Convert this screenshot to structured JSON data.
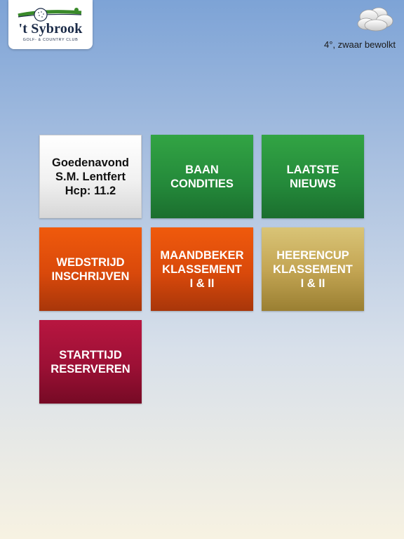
{
  "header": {
    "logo": {
      "name": "'t Sybrook",
      "subtitle": "GOLF- & COUNTRY CLUB"
    },
    "weather": {
      "icon": "cloud-icon",
      "text": "4°, zwaar bewolkt"
    }
  },
  "tiles": [
    {
      "label": "Goedenavond\nS.M. Lentfert\nHcp: 11.2",
      "color": "#f2f2f2"
    },
    {
      "label": "BAAN\nCONDITIES",
      "color": "#24893a"
    },
    {
      "label": "LAATSTE\nNIEUWS",
      "color": "#24893a"
    },
    {
      "label": "WEDSTRIJD\nINSCHRIJVEN",
      "color": "#d9490b"
    },
    {
      "label": "MAANDBEKER\nKLASSEMENT\nI & II",
      "color": "#d9490b"
    },
    {
      "label": "HEERENCUP\nKLASSEMENT\nI & II",
      "color": "#c4a654"
    },
    {
      "label": "STARTTIJD\nRESERVEREN",
      "color": "#9c1035"
    }
  ]
}
